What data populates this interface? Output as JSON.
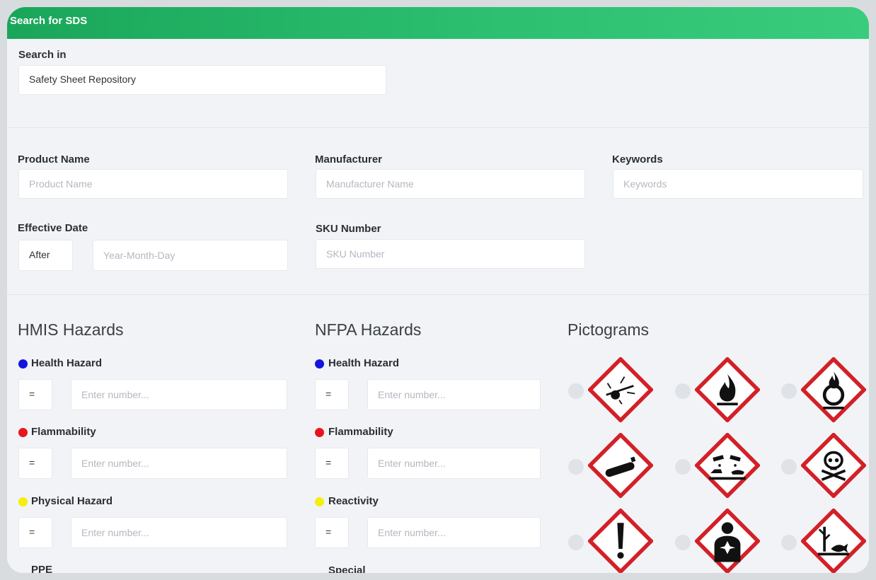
{
  "header": {
    "title": "Search for SDS"
  },
  "search_in": {
    "label": "Search in",
    "value": "Safety Sheet Repository"
  },
  "fields": {
    "product_name": {
      "label": "Product Name",
      "placeholder": "Product Name"
    },
    "manufacturer": {
      "label": "Manufacturer",
      "placeholder": "Manufacturer Name"
    },
    "keywords": {
      "label": "Keywords",
      "placeholder": "Keywords"
    },
    "effective_date": {
      "label": "Effective Date",
      "operator": "After",
      "placeholder": "Year-Month-Day"
    },
    "sku": {
      "label": "SKU Number",
      "placeholder": "SKU Number"
    }
  },
  "hmis": {
    "title": "HMIS Hazards",
    "items": [
      {
        "label": "Health Hazard",
        "color": "#1414e0",
        "operator": "=",
        "placeholder": "Enter number..."
      },
      {
        "label": "Flammability",
        "color": "#e8141e",
        "operator": "=",
        "placeholder": "Enter number..."
      },
      {
        "label": "Physical Hazard",
        "color": "#f5ee10",
        "operator": "=",
        "placeholder": "Enter number..."
      }
    ],
    "next_label": "PPE"
  },
  "nfpa": {
    "title": "NFPA Hazards",
    "items": [
      {
        "label": "Health Hazard",
        "color": "#1414e0",
        "operator": "=",
        "placeholder": "Enter number..."
      },
      {
        "label": "Flammability",
        "color": "#e8141e",
        "operator": "=",
        "placeholder": "Enter number..."
      },
      {
        "label": "Reactivity",
        "color": "#f5ee10",
        "operator": "=",
        "placeholder": "Enter number..."
      }
    ],
    "next_label": "Special"
  },
  "pictograms": {
    "title": "Pictograms",
    "icons": [
      "exploding-bomb-icon",
      "flame-icon",
      "flame-over-circle-icon",
      "gas-cylinder-icon",
      "corrosion-icon",
      "skull-crossbones-icon",
      "exclamation-mark-icon",
      "health-hazard-icon",
      "environment-icon"
    ]
  },
  "colors": {
    "header": "#2cbf70",
    "pictogram_border": "#d32027"
  }
}
